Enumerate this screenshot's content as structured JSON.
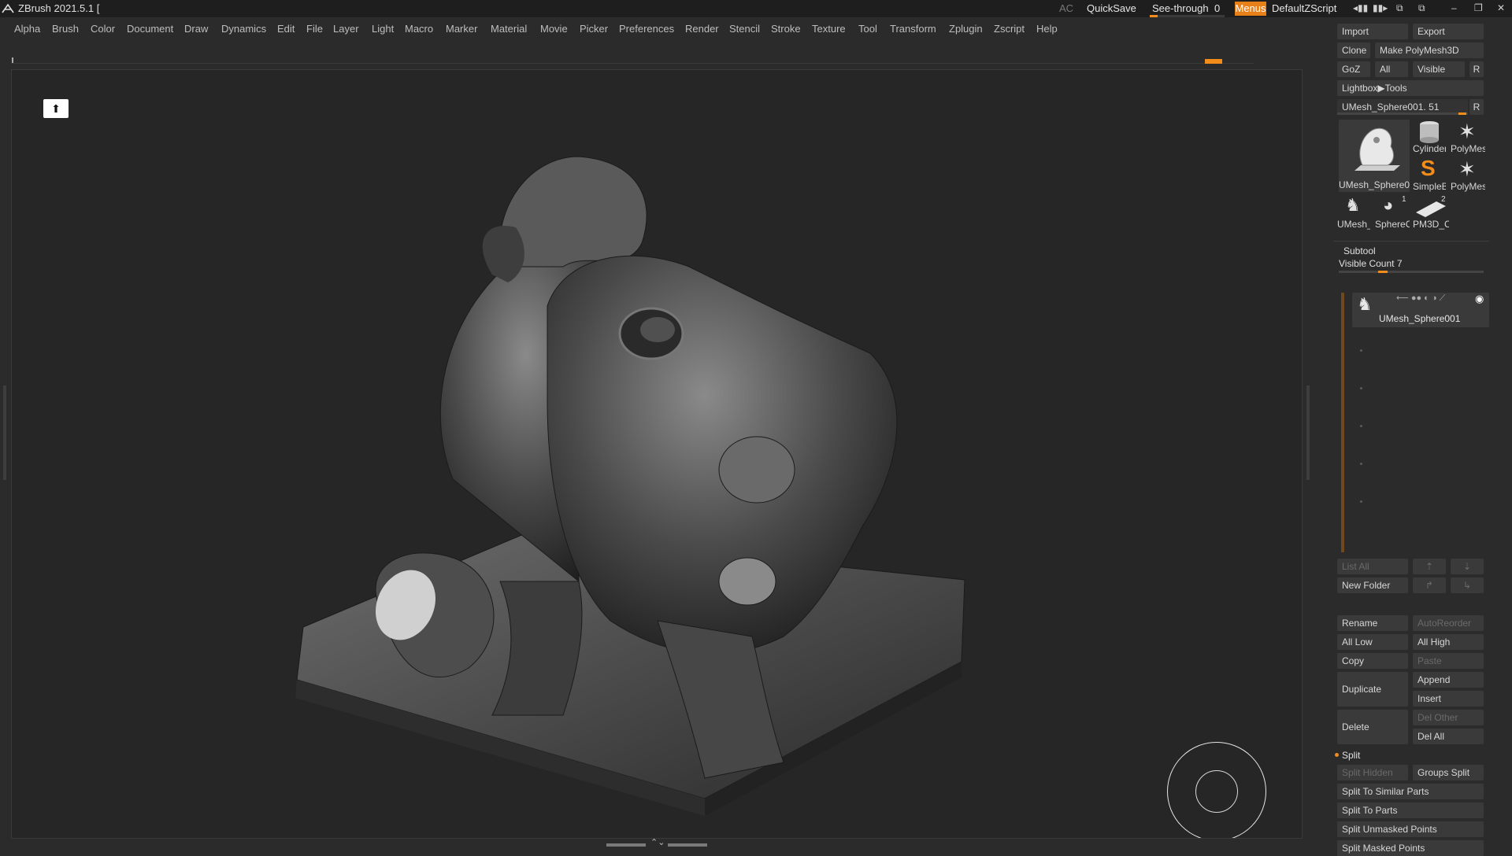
{
  "app": {
    "title": "ZBrush 2021.5.1 [",
    "ac_label": "AC",
    "quicksave": "QuickSave",
    "seethrough_label": "See-through",
    "seethrough_value": "0",
    "seethrough_level": 0.0,
    "menus_button": "Menus",
    "default_zscript": "DefaultZScript",
    "accent_color": "#f28c1b"
  },
  "menubar": {
    "items": [
      "Alpha",
      "Brush",
      "Color",
      "Document",
      "Draw",
      "Dynamics",
      "Edit",
      "File",
      "Layer",
      "Light",
      "Macro",
      "Marker",
      "Material",
      "Movie",
      "Picker",
      "Preferences",
      "Render",
      "Stencil",
      "Stroke",
      "Texture",
      "Tool",
      "Transform",
      "Zplugin",
      "Zscript",
      "Help"
    ]
  },
  "tool_panel": {
    "import": "Import",
    "export": "Export",
    "clone": "Clone",
    "make_polymesh": "Make PolyMesh3D",
    "goz": "GoZ",
    "all": "All",
    "visible": "Visible",
    "r": "R",
    "lightbox_tools": "Lightbox▶Tools",
    "current_tool": "UMesh_Sphere001. 51",
    "thumbs": [
      {
        "label": "UMesh_Sphere0",
        "icon": "sculpt-thumbnail-icon"
      },
      {
        "label": "Cylinder",
        "icon": "cylinder-icon"
      },
      {
        "label": "PolyMes",
        "icon": "polymesh-star-icon"
      },
      {
        "label": "SimpleB",
        "icon": "simplebrush-s-icon"
      },
      {
        "label": "PolyMes",
        "icon": "polymesh-star-icon"
      },
      {
        "label": "UMesh_",
        "icon": "sculpt-thumbnail-icon"
      },
      {
        "label": "SphereC",
        "icon": "sphere-icon"
      },
      {
        "label": "PM3D_C",
        "icon": "plane-icon"
      }
    ],
    "thumb_badges": [
      "1",
      "2"
    ]
  },
  "subtool": {
    "title": "Subtool",
    "visible_count": "Visible Count 7",
    "item_name": "UMesh_Sphere001",
    "list_all": "List All",
    "new_folder": "New Folder",
    "rename": "Rename",
    "auto_reorder": "AutoReorder",
    "all_low": "All Low",
    "all_high": "All High",
    "copy": "Copy",
    "paste": "Paste",
    "duplicate": "Duplicate",
    "append": "Append",
    "insert": "Insert",
    "delete": "Delete",
    "del_other": "Del Other",
    "del_all": "Del All"
  },
  "split": {
    "title": "Split",
    "split_hidden": "Split Hidden",
    "groups_split": "Groups Split",
    "split_similar": "Split To Similar Parts",
    "split_parts": "Split To Parts",
    "split_unmasked": "Split Unmasked Points",
    "split_masked": "Split Masked Points"
  }
}
